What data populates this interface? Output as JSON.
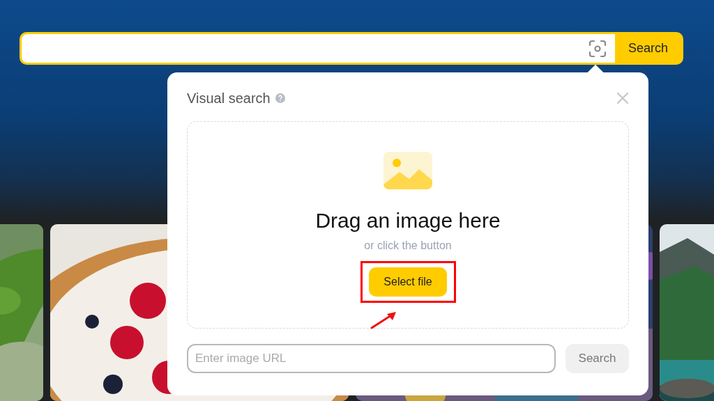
{
  "search_bar": {
    "button": "Search"
  },
  "visual_search": {
    "title": "Visual search",
    "drop_zone": {
      "heading": "Drag an image here",
      "hint": "or click the button",
      "button": "Select file"
    },
    "url_field": {
      "placeholder": "Enter image URL"
    },
    "url_button": "Search"
  }
}
